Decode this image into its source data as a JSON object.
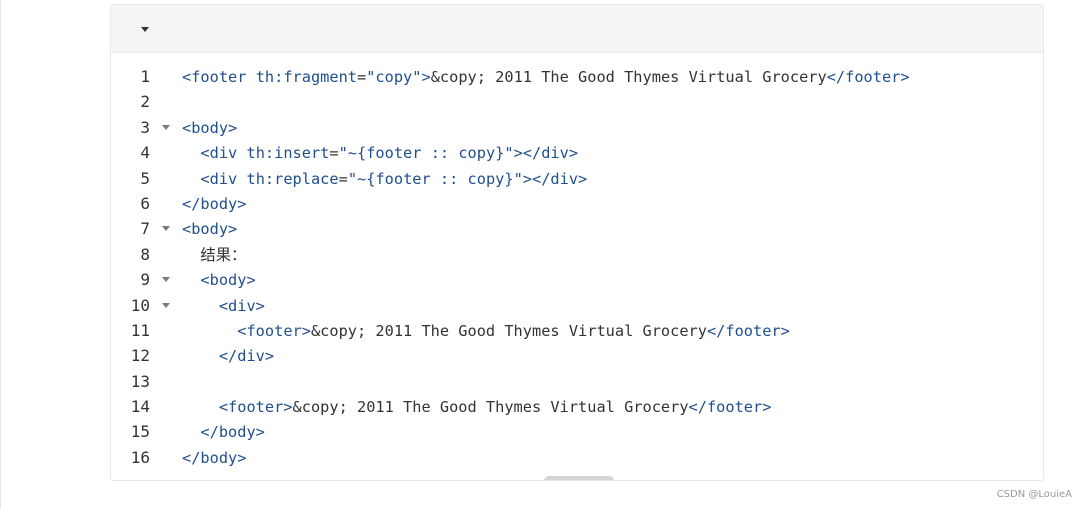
{
  "code_block": {
    "collapse_icon": "caret-down-icon",
    "lines": [
      {
        "number": "1",
        "foldable": false,
        "tokens": [
          {
            "t": "tag",
            "v": "<footer"
          },
          {
            "t": "txt",
            "v": " "
          },
          {
            "t": "attr",
            "v": "th:fragment"
          },
          {
            "t": "txt",
            "v": "="
          },
          {
            "t": "str",
            "v": "\"copy\""
          },
          {
            "t": "tag",
            "v": ">"
          },
          {
            "t": "txt",
            "v": "&copy; 2011 The Good Thymes Virtual Grocery"
          },
          {
            "t": "tag",
            "v": "</footer>"
          }
        ]
      },
      {
        "number": "2",
        "foldable": false,
        "tokens": []
      },
      {
        "number": "3",
        "foldable": true,
        "tokens": [
          {
            "t": "tag",
            "v": "<body>"
          }
        ]
      },
      {
        "number": "4",
        "foldable": false,
        "tokens": [
          {
            "t": "txt",
            "v": "  "
          },
          {
            "t": "tag",
            "v": "<div"
          },
          {
            "t": "txt",
            "v": " "
          },
          {
            "t": "attr",
            "v": "th:insert"
          },
          {
            "t": "txt",
            "v": "="
          },
          {
            "t": "str",
            "v": "\"~{footer :: copy}\""
          },
          {
            "t": "tag",
            "v": "></div>"
          }
        ]
      },
      {
        "number": "5",
        "foldable": false,
        "tokens": [
          {
            "t": "txt",
            "v": "  "
          },
          {
            "t": "tag",
            "v": "<div"
          },
          {
            "t": "txt",
            "v": " "
          },
          {
            "t": "attr",
            "v": "th:replace"
          },
          {
            "t": "txt",
            "v": "="
          },
          {
            "t": "str",
            "v": "\"~{footer :: copy}\""
          },
          {
            "t": "tag",
            "v": "></div>"
          }
        ]
      },
      {
        "number": "6",
        "foldable": false,
        "tokens": [
          {
            "t": "tag",
            "v": "</body>"
          }
        ]
      },
      {
        "number": "7",
        "foldable": true,
        "tokens": [
          {
            "t": "tag",
            "v": "<body>"
          }
        ]
      },
      {
        "number": "8",
        "foldable": false,
        "tokens": [
          {
            "t": "txt",
            "v": "  "
          },
          {
            "t": "note",
            "v": "结果："
          }
        ]
      },
      {
        "number": "9",
        "foldable": true,
        "tokens": [
          {
            "t": "txt",
            "v": "  "
          },
          {
            "t": "tag",
            "v": "<body>"
          }
        ]
      },
      {
        "number": "10",
        "foldable": true,
        "tokens": [
          {
            "t": "txt",
            "v": "    "
          },
          {
            "t": "tag",
            "v": "<div>"
          }
        ]
      },
      {
        "number": "11",
        "foldable": false,
        "tokens": [
          {
            "t": "txt",
            "v": "      "
          },
          {
            "t": "tag",
            "v": "<footer>"
          },
          {
            "t": "txt",
            "v": "&copy; 2011 The Good Thymes Virtual Grocery"
          },
          {
            "t": "tag",
            "v": "</footer>"
          }
        ]
      },
      {
        "number": "12",
        "foldable": false,
        "tokens": [
          {
            "t": "txt",
            "v": "    "
          },
          {
            "t": "tag",
            "v": "</div>"
          }
        ]
      },
      {
        "number": "13",
        "foldable": false,
        "tokens": []
      },
      {
        "number": "14",
        "foldable": false,
        "tokens": [
          {
            "t": "txt",
            "v": "    "
          },
          {
            "t": "tag",
            "v": "<footer>"
          },
          {
            "t": "txt",
            "v": "&copy; 2011 The Good Thymes Virtual Grocery"
          },
          {
            "t": "tag",
            "v": "</footer>"
          }
        ]
      },
      {
        "number": "15",
        "foldable": false,
        "tokens": [
          {
            "t": "txt",
            "v": "  "
          },
          {
            "t": "tag",
            "v": "</body>"
          }
        ]
      },
      {
        "number": "16",
        "foldable": false,
        "tokens": [
          {
            "t": "tag",
            "v": "</body>"
          }
        ]
      }
    ]
  },
  "colors": {
    "syntax_blue": "#1f4f8f",
    "text": "#333333",
    "header_bg": "#f5f5f5"
  },
  "watermark": "CSDN @LouieA"
}
